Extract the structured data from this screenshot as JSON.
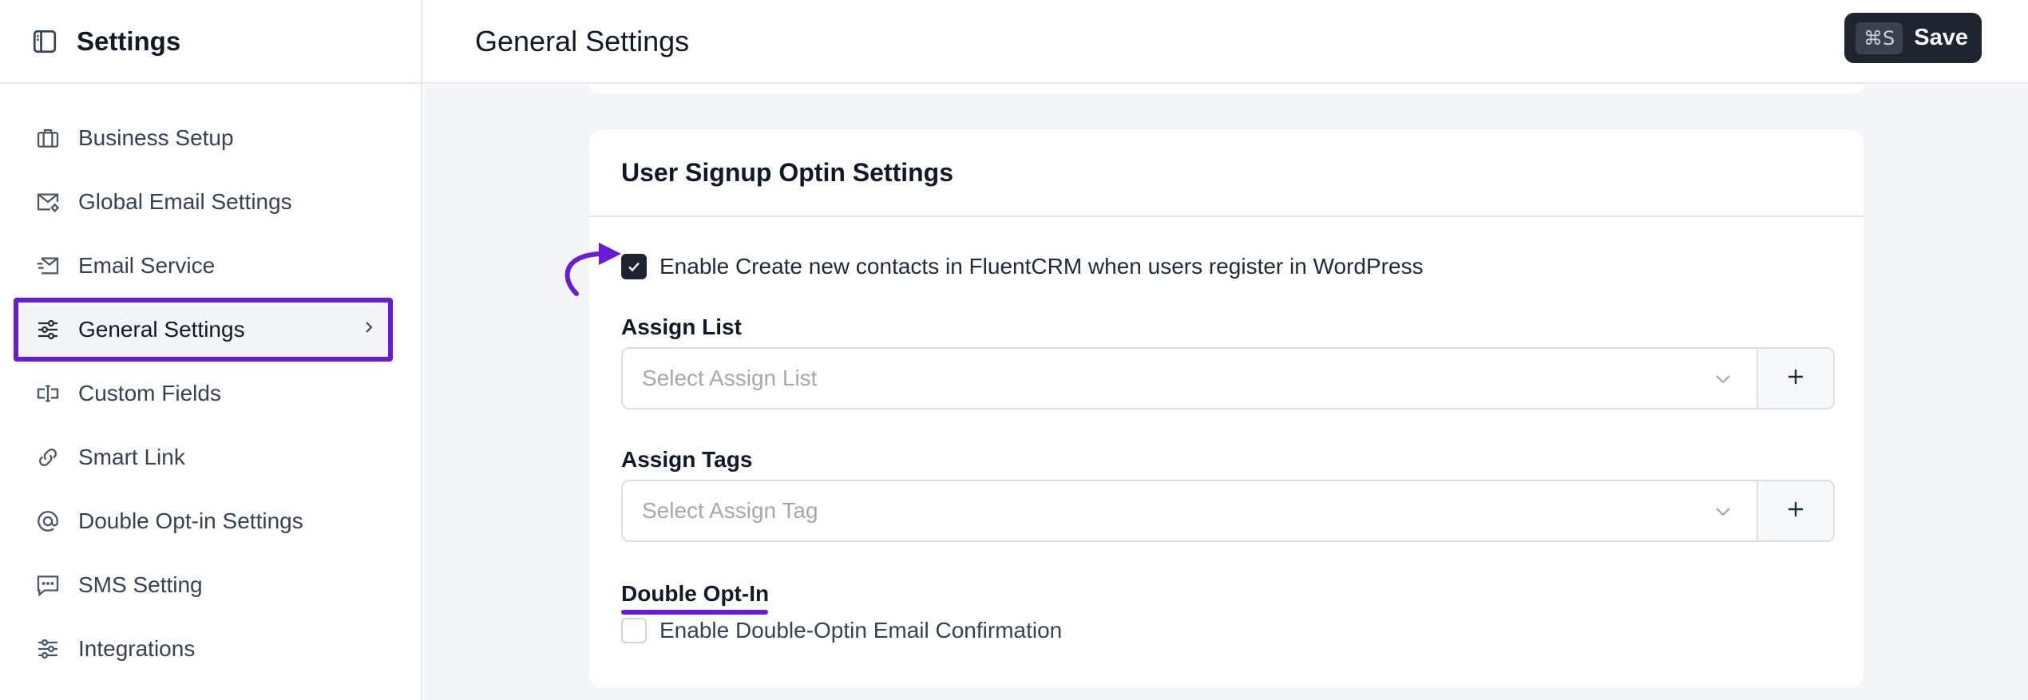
{
  "sidebar": {
    "title": "Settings",
    "items": [
      {
        "label": "Business Setup",
        "icon": "briefcase-icon"
      },
      {
        "label": "Global Email Settings",
        "icon": "mail-gear-icon"
      },
      {
        "label": "Email Service",
        "icon": "send-mail-icon"
      },
      {
        "label": "General Settings",
        "icon": "sliders-icon",
        "active": true
      },
      {
        "label": "Custom Fields",
        "icon": "text-cursor-icon"
      },
      {
        "label": "Smart Link",
        "icon": "link-icon"
      },
      {
        "label": "Double Opt-in Settings",
        "icon": "at-sign-icon"
      },
      {
        "label": "SMS Setting",
        "icon": "chat-icon"
      },
      {
        "label": "Integrations",
        "icon": "sliders-icon"
      }
    ]
  },
  "header": {
    "title": "General Settings",
    "shortcut": "⌘S",
    "save_label": "Save"
  },
  "card": {
    "title": "User Signup Optin Settings",
    "enable_label": "Enable Create new contacts in FluentCRM when users register in WordPress",
    "enable_checked": true,
    "assign_list": {
      "label": "Assign List",
      "placeholder": "Select Assign List"
    },
    "assign_tags": {
      "label": "Assign Tags",
      "placeholder": "Select Assign Tag"
    },
    "double_optin": {
      "label": "Double Opt-In",
      "checkbox_label": "Enable Double-Optin Email Confirmation",
      "checked": false
    }
  },
  "colors": {
    "accent": "#6a1ad9",
    "dark": "#1f2430",
    "background": "#f4f5f8"
  }
}
